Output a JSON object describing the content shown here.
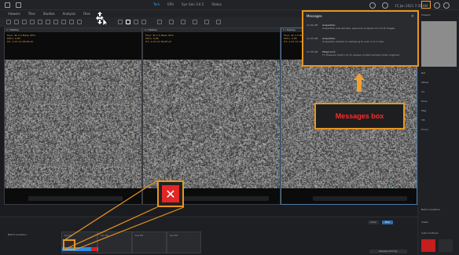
{
  "titlebar": {
    "center_items": [
      "Tem",
      "EPU",
      "Syn Gen 3.6.5",
      "Status"
    ],
    "datetime": "15 Jan 2021 7:35 AM"
  },
  "menubar": {
    "items": [
      "Viewers",
      "Tiles",
      "Studies",
      "Analysis",
      "Files"
    ]
  },
  "viewers": [
    {
      "header": "1 / Epitaxy",
      "info": [
        "Fluor: 4k 1.5 Mass: 60%",
        "PSF-L: 0.85",
        "ITL: 1.23 nm 99.95 eV"
      ]
    },
    {
      "header": "1 / Epitaxy",
      "info": [
        "Fluor: 4k 1.5 Mass: 60%",
        "PSF-L: 0.85",
        "ITL: 1.23 nm 99.95 eV"
      ]
    },
    {
      "header": "1 / Epitaxy",
      "info": [
        "Fluor: 4k 1.5 Mass: 60%",
        "PSF-L: 0.85",
        "ITL: 1.23 nm 99.95 eV"
      ]
    }
  ],
  "messages": {
    "title": "Messages",
    "close": "×",
    "items": [
      {
        "time": "11:02 AM",
        "title": "Acquisition",
        "body": "Acquisition was aborted, exposure of spectrum 3 of 8 images."
      },
      {
        "time": "11:03 AM",
        "title": "Acquisition",
        "body": "Acquisition started on sample grid, scan 3 of 2 rows."
      },
      {
        "time": "11:05 AM",
        "title": "Stage Lock",
        "body": "TI: Pressure check not ok, please contact sample holder engineer."
      }
    ]
  },
  "callout": {
    "label": "Messages box"
  },
  "bottom": {
    "section_label": "Batch Locations",
    "cards": [
      "Loc 01",
      "Loc 02",
      "Loc 03",
      "Loc 04"
    ],
    "buttons": [
      "Clear",
      "Run"
    ],
    "dropdown": "Release Priority"
  },
  "sidebar": {
    "header": "Viewers",
    "rows": [
      "Ref",
      "Offset",
      "Int",
      "Dose",
      "Mag",
      "Tilt",
      "Focus"
    ],
    "bottom_labels": [
      "Batch Locations",
      "Views",
      "Auto Continue"
    ]
  },
  "colors": {
    "highlight": "#e8951f",
    "error": "#e32626",
    "accent": "#2ea3ff",
    "progress": "#2b8ee8"
  }
}
